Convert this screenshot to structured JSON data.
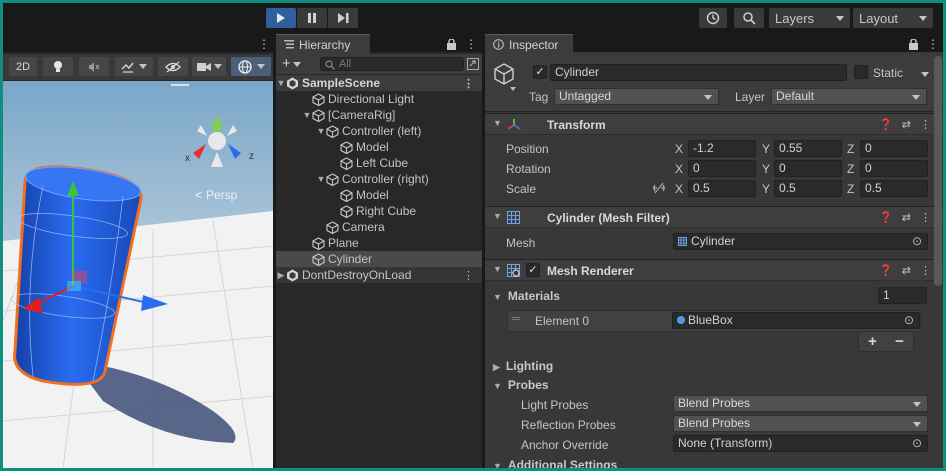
{
  "toolbar": {
    "layers_label": "Layers",
    "layout_label": "Layout"
  },
  "scene": {
    "btn_2d": "2D",
    "persp_label": "Persp",
    "gizmo_axes": {
      "x": "x",
      "z": "z"
    }
  },
  "hierarchy": {
    "tab_label": "Hierarchy",
    "search_placeholder": "All",
    "items": [
      {
        "label": "SampleScene",
        "depth": 0,
        "type": "scene",
        "expanded": true
      },
      {
        "label": "Directional Light",
        "depth": 1,
        "type": "object"
      },
      {
        "label": "[CameraRig]",
        "depth": 1,
        "type": "object",
        "expanded": true
      },
      {
        "label": "Controller (left)",
        "depth": 2,
        "type": "object",
        "expanded": true
      },
      {
        "label": "Model",
        "depth": 3,
        "type": "object"
      },
      {
        "label": "Left Cube",
        "depth": 3,
        "type": "object"
      },
      {
        "label": "Controller (right)",
        "depth": 2,
        "type": "object",
        "expanded": true
      },
      {
        "label": "Model",
        "depth": 3,
        "type": "object"
      },
      {
        "label": "Right Cube",
        "depth": 3,
        "type": "object"
      },
      {
        "label": "Camera",
        "depth": 2,
        "type": "object"
      },
      {
        "label": "Plane",
        "depth": 1,
        "type": "object"
      },
      {
        "label": "Cylinder",
        "depth": 1,
        "type": "object",
        "selected": true
      },
      {
        "label": "DontDestroyOnLoad",
        "depth": 0,
        "type": "scene",
        "expanded": false
      }
    ]
  },
  "inspector": {
    "tab_label": "Inspector",
    "object_name": "Cylinder",
    "active": true,
    "static_label": "Static",
    "tag_label": "Tag",
    "tag_value": "Untagged",
    "layer_label": "Layer",
    "layer_value": "Default",
    "transform": {
      "title": "Transform",
      "position_label": "Position",
      "rotation_label": "Rotation",
      "scale_label": "Scale",
      "position": {
        "x": "-1.2",
        "y": "0.55",
        "z": "0"
      },
      "rotation": {
        "x": "0",
        "y": "0",
        "z": "0"
      },
      "scale": {
        "x": "0.5",
        "y": "0.5",
        "z": "0.5"
      }
    },
    "mesh_filter": {
      "title": "Cylinder (Mesh Filter)",
      "mesh_label": "Mesh",
      "mesh_value": "Cylinder"
    },
    "mesh_renderer": {
      "title": "Mesh Renderer",
      "enabled": true,
      "materials_label": "Materials",
      "materials_count": "1",
      "element_label": "Element 0",
      "element_value": "BlueBox",
      "plus": "+",
      "minus": "−",
      "lighting_label": "Lighting",
      "probes_label": "Probes",
      "light_probes_label": "Light Probes",
      "light_probes_value": "Blend Probes",
      "reflection_probes_label": "Reflection Probes",
      "reflection_probes_value": "Blend Probes",
      "anchor_override_label": "Anchor Override",
      "anchor_override_value": "None (Transform)",
      "additional_settings_label": "Additional Settings"
    },
    "axis_labels": {
      "x": "X",
      "y": "Y",
      "z": "Z"
    }
  },
  "colors": {
    "play_active": "#2f5f9e",
    "cylinder_blue": "#1f5fd6",
    "selection_outline": "#f07020",
    "frame_teal": "#0f8f7f"
  }
}
